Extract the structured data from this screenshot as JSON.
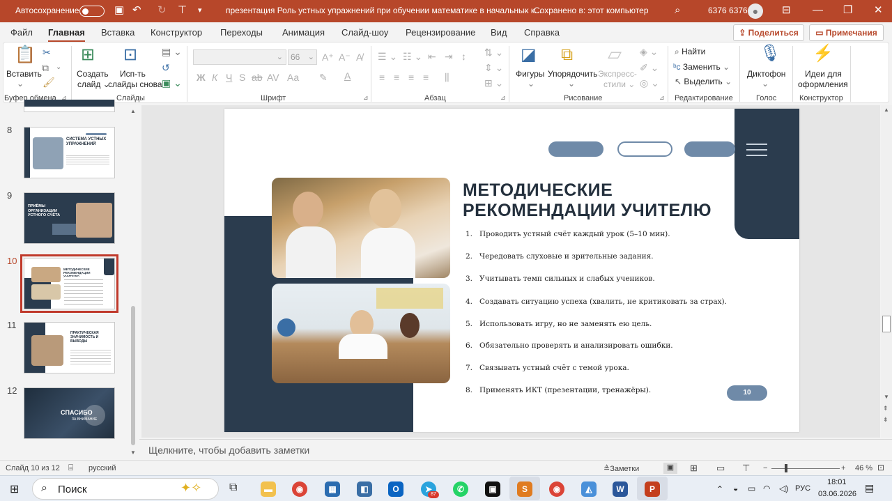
{
  "titlebar": {
    "autosave_label": "Автосохранение",
    "doc_title": "презентация Роль устных упражнений при обучении математике в начальных к...",
    "save_status": "Сохранено в: этот компьютер",
    "user": "6376 6376"
  },
  "tabs": [
    "Файл",
    "Главная",
    "Вставка",
    "Конструктор",
    "Переходы",
    "Анимация",
    "Слайд-шоу",
    "Рецензирование",
    "Вид",
    "Справка"
  ],
  "share_label": "Поделиться",
  "comments_label": "Примечания",
  "ribbon": {
    "paste": "Вставить",
    "new_slide_1": "Создать",
    "new_slide_2": "слайд",
    "reuse_1": "Исп-ть",
    "reuse_2": "слайды снова",
    "font_size": "66",
    "shapes": "Фигуры",
    "arrange": "Упорядочить",
    "quick_styles_1": "Экспресс-",
    "quick_styles_2": "стили",
    "find": "Найти",
    "replace": "Заменить",
    "select": "Выделить",
    "dictate": "Диктофон",
    "designer_1": "Идеи для",
    "designer_2": "оформления",
    "groups": {
      "clipboard": "Буфер обмена",
      "slides": "Слайды",
      "font": "Шрифт",
      "paragraph": "Абзац",
      "drawing": "Рисование",
      "editing": "Редактирование",
      "voice": "Голос",
      "designer": "Конструктор"
    }
  },
  "thumbnails": [
    {
      "num": "8",
      "title": "СИСТЕМА УСТНЫХ УПРАЖНЕНИЙ"
    },
    {
      "num": "9",
      "title": "ПРИЁМЫ ОРГАНИЗАЦИИ УСТНОГО СЧЁТА"
    },
    {
      "num": "10",
      "title": "МЕТОДИЧЕСКИЕ РЕКОМЕНДАЦИИ УЧИТЕЛЮ"
    },
    {
      "num": "11",
      "title": "ПРАКТИЧЕСКАЯ ЗНАЧИМОСТЬ И ВЫВОДЫ"
    },
    {
      "num": "12",
      "title": "СПАСИБО",
      "subtitle": "ЗА ВНИМАНИЕ"
    }
  ],
  "slide": {
    "title_line1": "МЕТОДИЧЕСКИЕ",
    "title_line2": "РЕКОМЕНДАЦИИ УЧИТЕЛЮ",
    "items": [
      {
        "n": "1.",
        "text": "Проводить устный счёт каждый урок (5–10 мин)."
      },
      {
        "n": "2.",
        "text": "Чередовать слуховые и зрительные задания."
      },
      {
        "n": "3.",
        "text": "Учитывать темп сильных и слабых учеников."
      },
      {
        "n": "4.",
        "text": "Создавать ситуацию успеха (хвалить, не критиковать за страх)."
      },
      {
        "n": "5.",
        "text": "Использовать игру, но не заменять ею цель."
      },
      {
        "n": "6.",
        "text": "Обязательно проверять и анализировать ошибки."
      },
      {
        "n": "7.",
        "text": "Связывать устный счёт с темой урока."
      },
      {
        "n": "8.",
        "text": "Применять ИКТ (презентации, тренажёры)."
      }
    ],
    "page_number": "10"
  },
  "notes_placeholder": "Щелкните, чтобы добавить заметки",
  "status": {
    "slide_of": "Слайд 10 из 12",
    "language": "русский",
    "notes_btn": "Заметки",
    "zoom": "46 %"
  },
  "taskbar": {
    "search": "Поиск",
    "lang": "РУС",
    "time": "18:01",
    "date": "03.06.2026",
    "telegram_badge": "87"
  },
  "colors": {
    "accent": "#b7472a",
    "navy": "#2b3c4e",
    "pill": "#6f8aa8"
  }
}
